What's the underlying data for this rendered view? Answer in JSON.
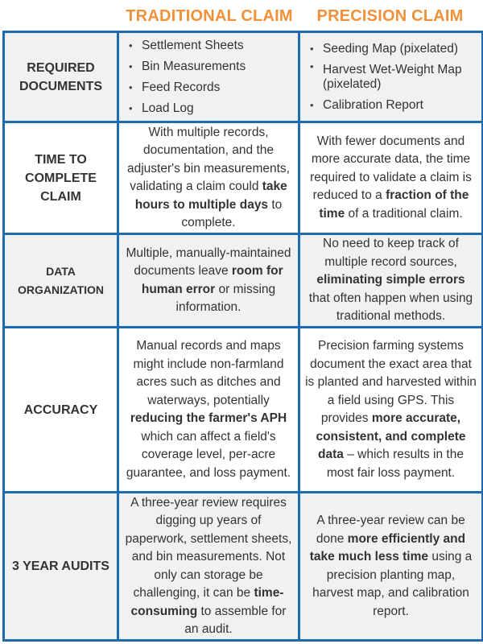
{
  "columns": {
    "traditional": "TRADITIONAL CLAIM",
    "precision": "PRECISION CLAIM"
  },
  "rows": [
    {
      "label": "REQUIRED DOCUMENTS",
      "traditional_list": [
        "Settlement Sheets",
        "Bin Measurements",
        "Feed Records",
        "Load Log"
      ],
      "precision_list": [
        "Seeding Map (pixelated)",
        "Harvest Wet-Weight Map (pixelated)",
        "Calibration Report"
      ]
    },
    {
      "label": "TIME TO COMPLETE CLAIM",
      "traditional": {
        "pre": "With multiple records, documentation, and the adjuster's bin measurements, validating a claim could ",
        "bold": "take hours to multiple days",
        "post": " to complete."
      },
      "precision": {
        "pre": "With fewer documents and more accurate data, the time required to validate a claim is reduced to a ",
        "bold": "fraction of the time",
        "post": " of a traditional claim."
      }
    },
    {
      "label": "DATA ORGANIZATION",
      "traditional": {
        "pre": "Multiple, manually-maintained documents leave ",
        "bold": "room for human error",
        "post": " or missing information."
      },
      "precision": {
        "pre": "No need to keep track of multiple record sources, ",
        "bold": "eliminating simple errors",
        "post": " that often happen when using traditional methods."
      }
    },
    {
      "label": "ACCURACY",
      "traditional": {
        "pre": "Manual records and maps might include non-farmland acres such as ditches and waterways, potentially ",
        "bold": "reducing the farmer's APH",
        "post": " which can affect a field's coverage level, per-acre guarantee, and loss payment."
      },
      "precision": {
        "pre": "Precision farming systems document the exact area that is planted and harvested within a field using GPS. This provides ",
        "bold": "more accurate, consistent, and complete data",
        "post": " – which results in the most fair loss payment."
      }
    },
    {
      "label": "3 YEAR AUDITS",
      "traditional": {
        "pre": "A three-year review requires digging up years of paperwork, settlement sheets, and bin measurements. Not only can storage be challenging, it can be ",
        "bold": "time-consuming",
        "post": " to assemble for an audit."
      },
      "precision": {
        "pre": "A three-year review can be done ",
        "bold": "more efficiently and take much less time",
        "post": " using a precision planting map, harvest map, and calibration report."
      }
    }
  ]
}
